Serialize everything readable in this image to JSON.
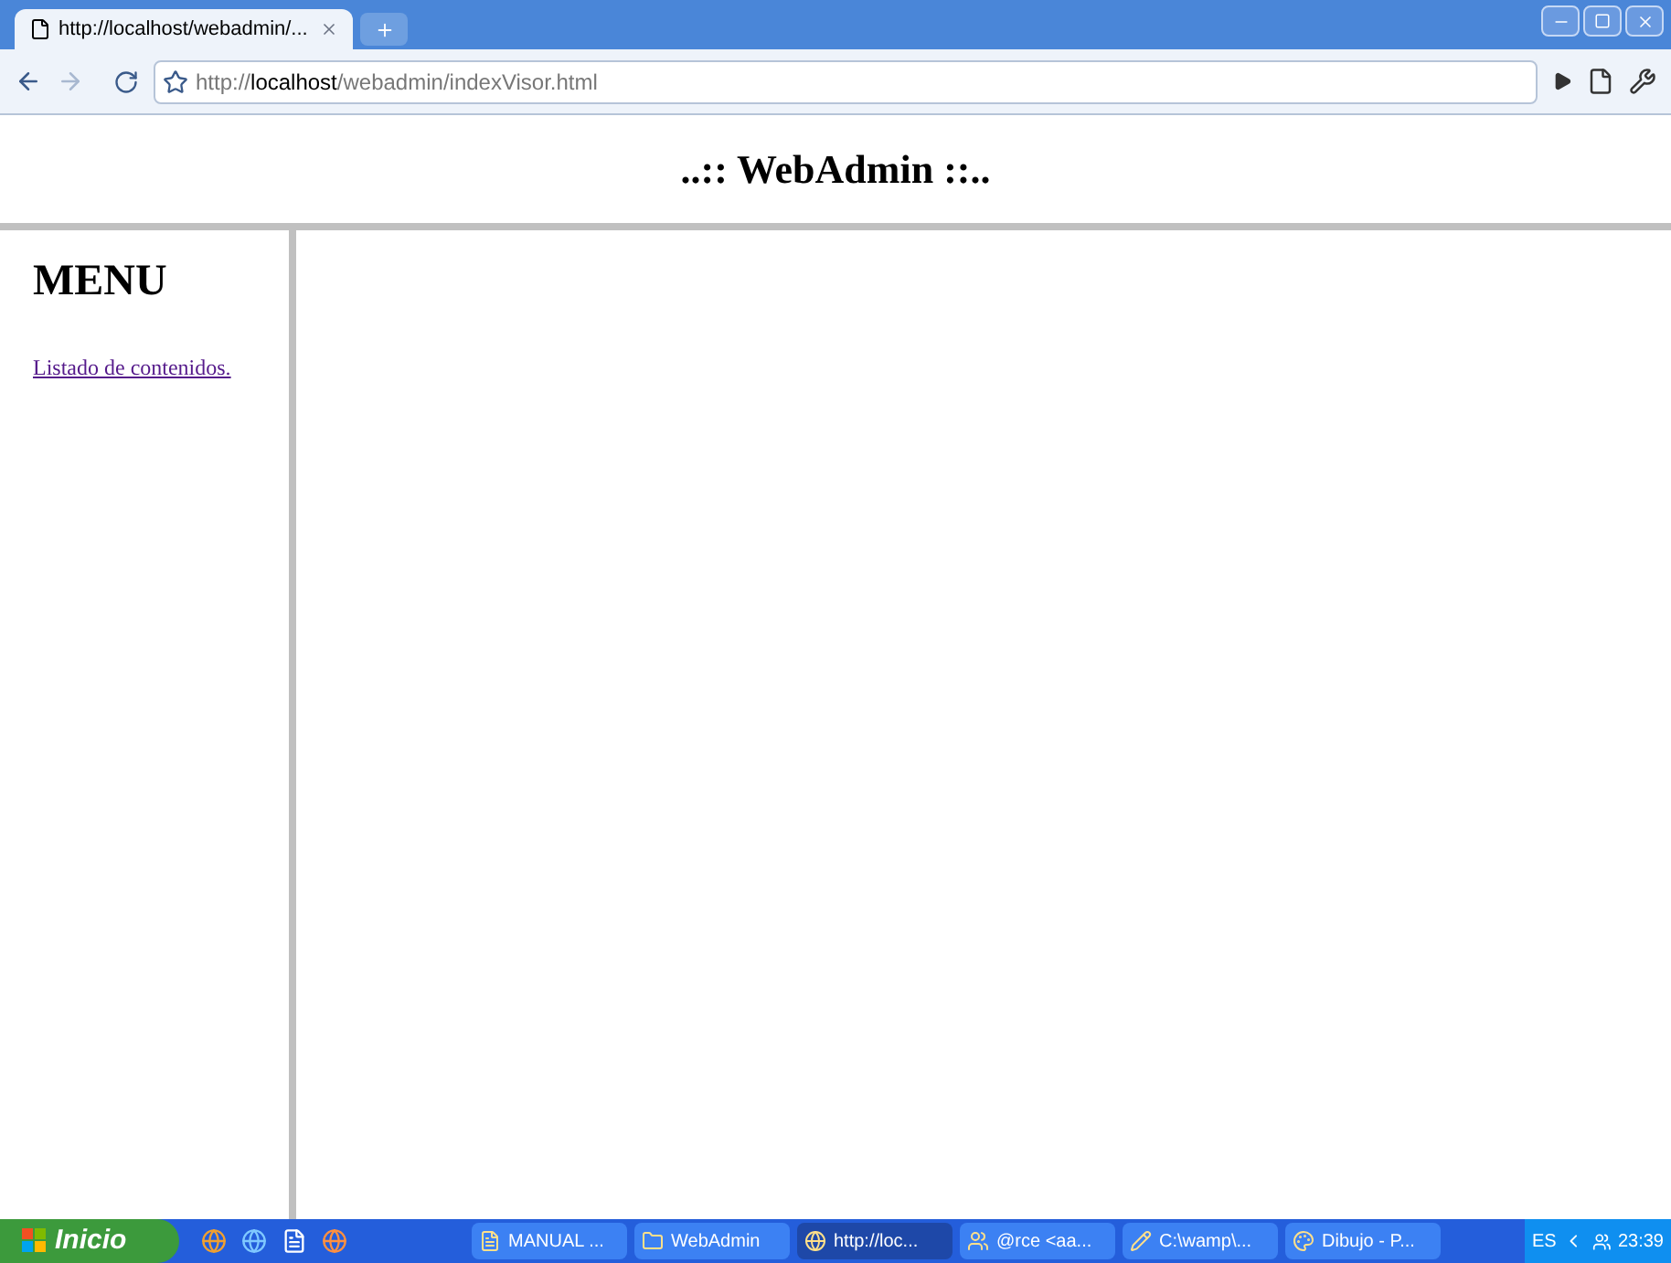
{
  "browser": {
    "tabs": [
      {
        "title": "http://localhost/webadmin/...",
        "selected": true
      }
    ],
    "address": "http://**localhost**/webadmin/indexVisor.html"
  },
  "header": {
    "title": "..:: WebAdmin ::.."
  },
  "menu": {
    "title": "MENU",
    "links": [
      "Listado de contenidos."
    ]
  },
  "taskbar": {
    "start": "Inicio",
    "tasks": [
      {
        "label": "MANUAL ...",
        "kind": "document",
        "selected": false
      },
      {
        "label": "WebAdmin",
        "kind": "folder",
        "selected": false
      },
      {
        "label": "http://loc...",
        "kind": "browser",
        "selected": true
      },
      {
        "label": "@rce <aa...",
        "kind": "people",
        "selected": false
      },
      {
        "label": "C:\\wamp\\...",
        "kind": "editor",
        "selected": false
      },
      {
        "label": "Dibujo - P...",
        "kind": "paint",
        "selected": false
      }
    ],
    "language": "ES",
    "clock": "23:39"
  }
}
